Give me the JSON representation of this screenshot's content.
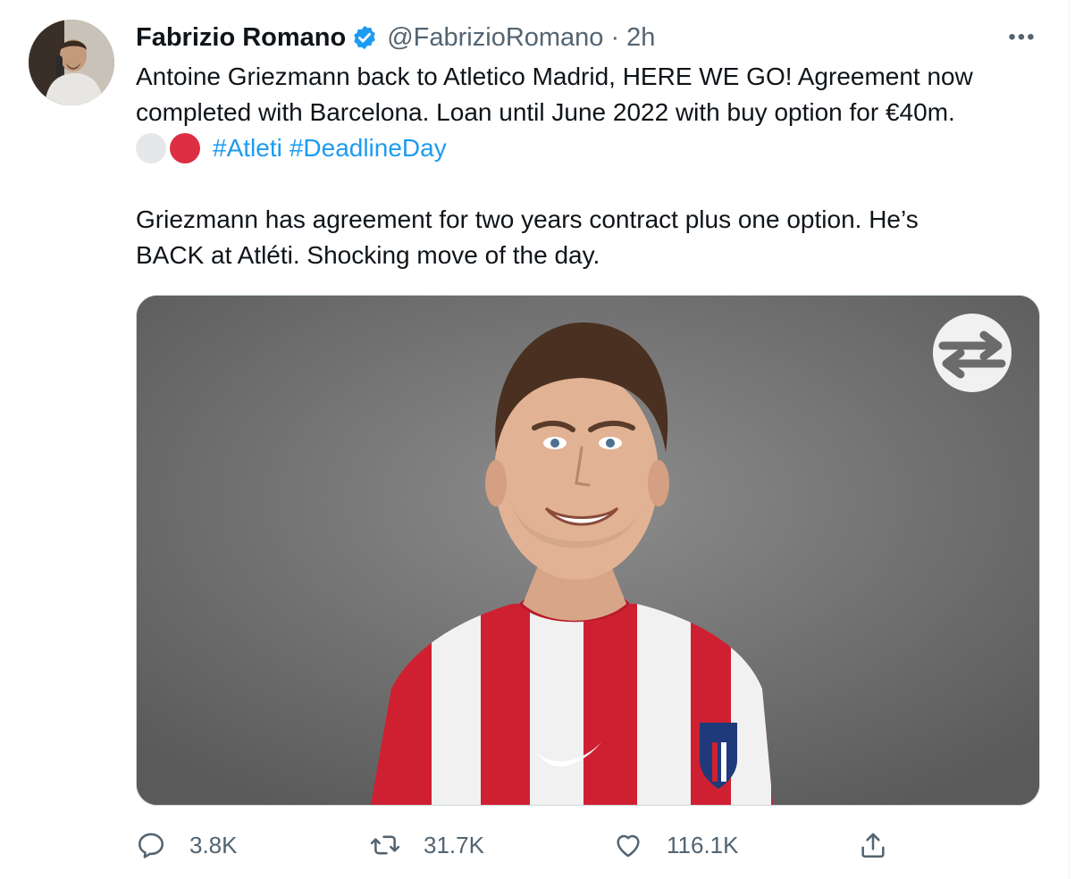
{
  "tweet": {
    "author": {
      "name": "Fabrizio Romano",
      "handle": "@FabrizioRomano",
      "separator": "·",
      "time": "2h"
    },
    "more_glyph": "•••",
    "text": {
      "line1": "Antoine Griezmann back to Atletico Madrid, HERE WE GO! Agreement now",
      "line2": "completed with Barcelona. Loan until June 2022 with buy option for €40m.",
      "hashtags": [
        "#Atleti",
        "#DeadlineDay"
      ],
      "para2_line1": "Griezmann has agreement for two years contract plus one option. He’s",
      "para2_line2": "BACK at Atléti. Shocking move of the day."
    },
    "media": {
      "overlay_icon": "transfer-arrows-icon"
    },
    "stats": {
      "replies": "3.8K",
      "retweets": "31.7K",
      "likes": "116.1K"
    }
  },
  "colors": {
    "text": "#0f1419",
    "secondary": "#536471",
    "link": "#1d9bf0",
    "verified": "#1d9bf0",
    "emoji_white": "#e6e7e8",
    "emoji_red": "#dd2e44",
    "kit_red": "#cf2031"
  },
  "icons": [
    "verified-badge-icon",
    "more-icon",
    "reply-icon",
    "retweet-icon",
    "like-icon",
    "share-icon"
  ]
}
